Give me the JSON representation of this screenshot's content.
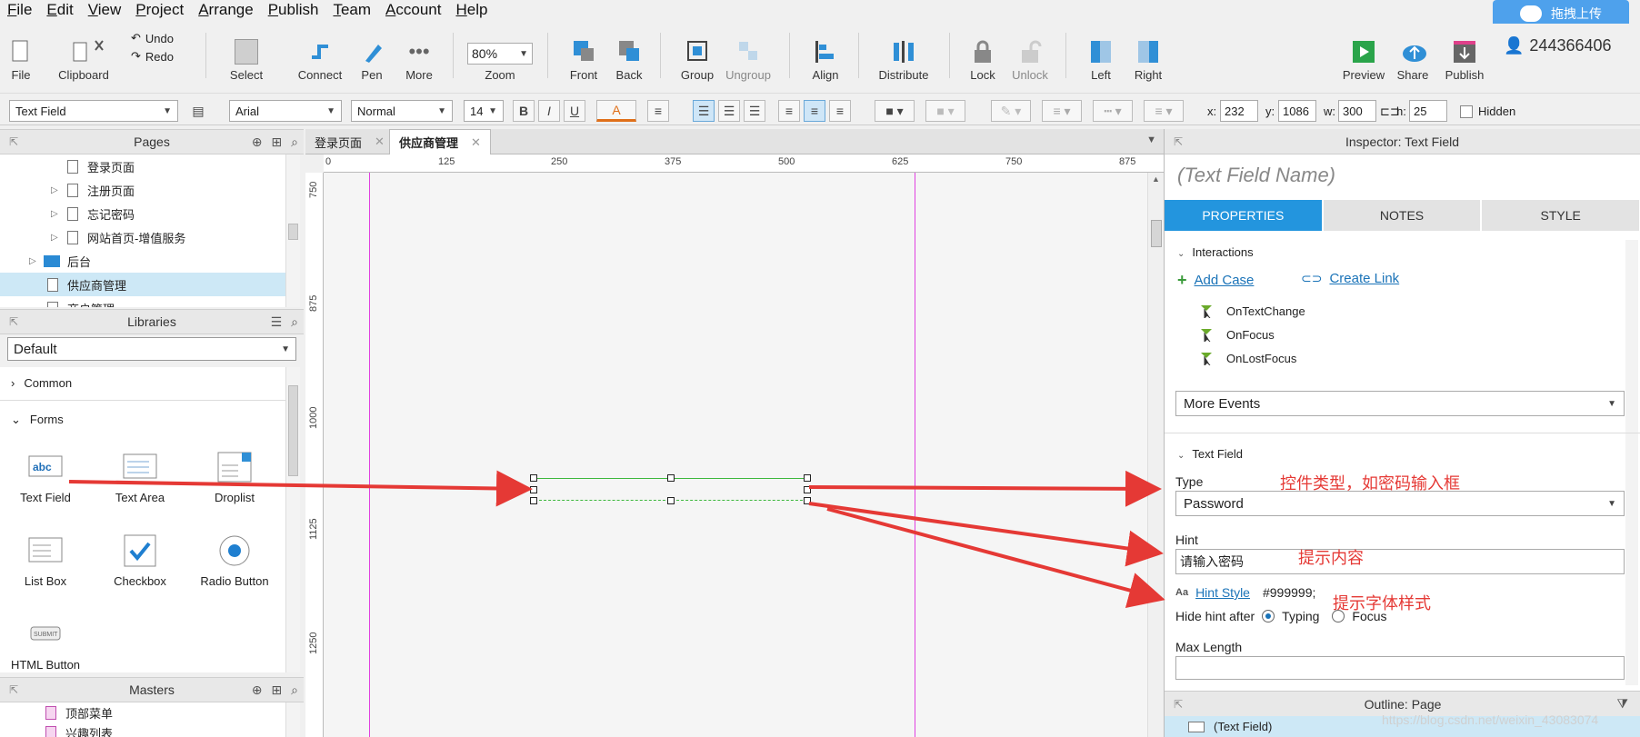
{
  "menu": [
    "File",
    "Edit",
    "View",
    "Project",
    "Arrange",
    "Publish",
    "Team",
    "Account",
    "Help"
  ],
  "upload_button": "拖拽上传",
  "toolbar": {
    "file": "File",
    "clipboard": "Clipboard",
    "undo": "Undo",
    "redo": "Redo",
    "select": "Select",
    "connect": "Connect",
    "pen": "Pen",
    "more": "More",
    "zoom_value": "80%",
    "zoom": "Zoom",
    "front": "Front",
    "back": "Back",
    "group": "Group",
    "ungroup": "Ungroup",
    "align": "Align",
    "distribute": "Distribute",
    "lock": "Lock",
    "unlock": "Unlock",
    "left": "Left",
    "right": "Right",
    "preview": "Preview",
    "share": "Share",
    "publish": "Publish",
    "user": "244366406"
  },
  "format": {
    "widget_type": "Text Field",
    "font": "Arial",
    "weight": "Normal",
    "size": "14",
    "bold": "B",
    "italic": "I",
    "underline": "U",
    "font_color": "A",
    "x_label": "x:",
    "x": "232",
    "y_label": "y:",
    "y": "1086",
    "w_label": "w:",
    "w": "300",
    "h_label": "h:",
    "h": "25",
    "hidden": "Hidden"
  },
  "pages": {
    "title": "Pages",
    "items": [
      "登录页面",
      "注册页面",
      "忘记密码",
      "网站首页-增值服务",
      "后台",
      "供应商管理",
      "商户管理"
    ]
  },
  "libraries": {
    "title": "Libraries",
    "selected": "Default",
    "sections": [
      "Common",
      "Forms"
    ],
    "widgets": [
      "Text Field",
      "Text Area",
      "Droplist",
      "List Box",
      "Checkbox",
      "Radio Button",
      "HTML Button"
    ],
    "abc": "abc",
    "submit": "SUBMIT"
  },
  "masters": {
    "title": "Masters",
    "items": [
      "顶部菜单",
      "兴趣列表"
    ]
  },
  "tabs": [
    "登录页面",
    "供应商管理"
  ],
  "ruler": {
    "top": [
      "0",
      "125",
      "250",
      "375",
      "500",
      "625",
      "750",
      "875"
    ],
    "left": [
      "750",
      "875",
      "1000",
      "1125",
      "1250"
    ]
  },
  "inspector": {
    "title": "Inspector: Text Field",
    "field_name": "(Text Field Name)",
    "tabs": [
      "PROPERTIES",
      "NOTES",
      "STYLE"
    ],
    "interactions": "Interactions",
    "add_case": "Add Case",
    "create_link": "Create Link",
    "events": [
      "OnTextChange",
      "OnFocus",
      "OnLostFocus"
    ],
    "more_events": "More Events",
    "text_field": "Text Field",
    "type_label": "Type",
    "type_value": "Password",
    "hint_label": "Hint",
    "hint_value": "请输入密码",
    "hint_style": "Hint Style",
    "hint_style_value": "#999999;",
    "hide_hint_after": "Hide hint after",
    "typing": "Typing",
    "focus": "Focus",
    "max_length": "Max Length",
    "outline_title": "Outline: Page",
    "outline_item": "(Text Field)"
  },
  "annotations": {
    "type_note": "控件类型，如密码输入框",
    "hint_note": "提示内容",
    "style_note": "提示字体样式"
  },
  "watermark": "https://blog.csdn.net/weixin_43083074",
  "colors": {
    "accent": "#2395de",
    "annotation": "#e53935",
    "guide": "#e040e0"
  }
}
